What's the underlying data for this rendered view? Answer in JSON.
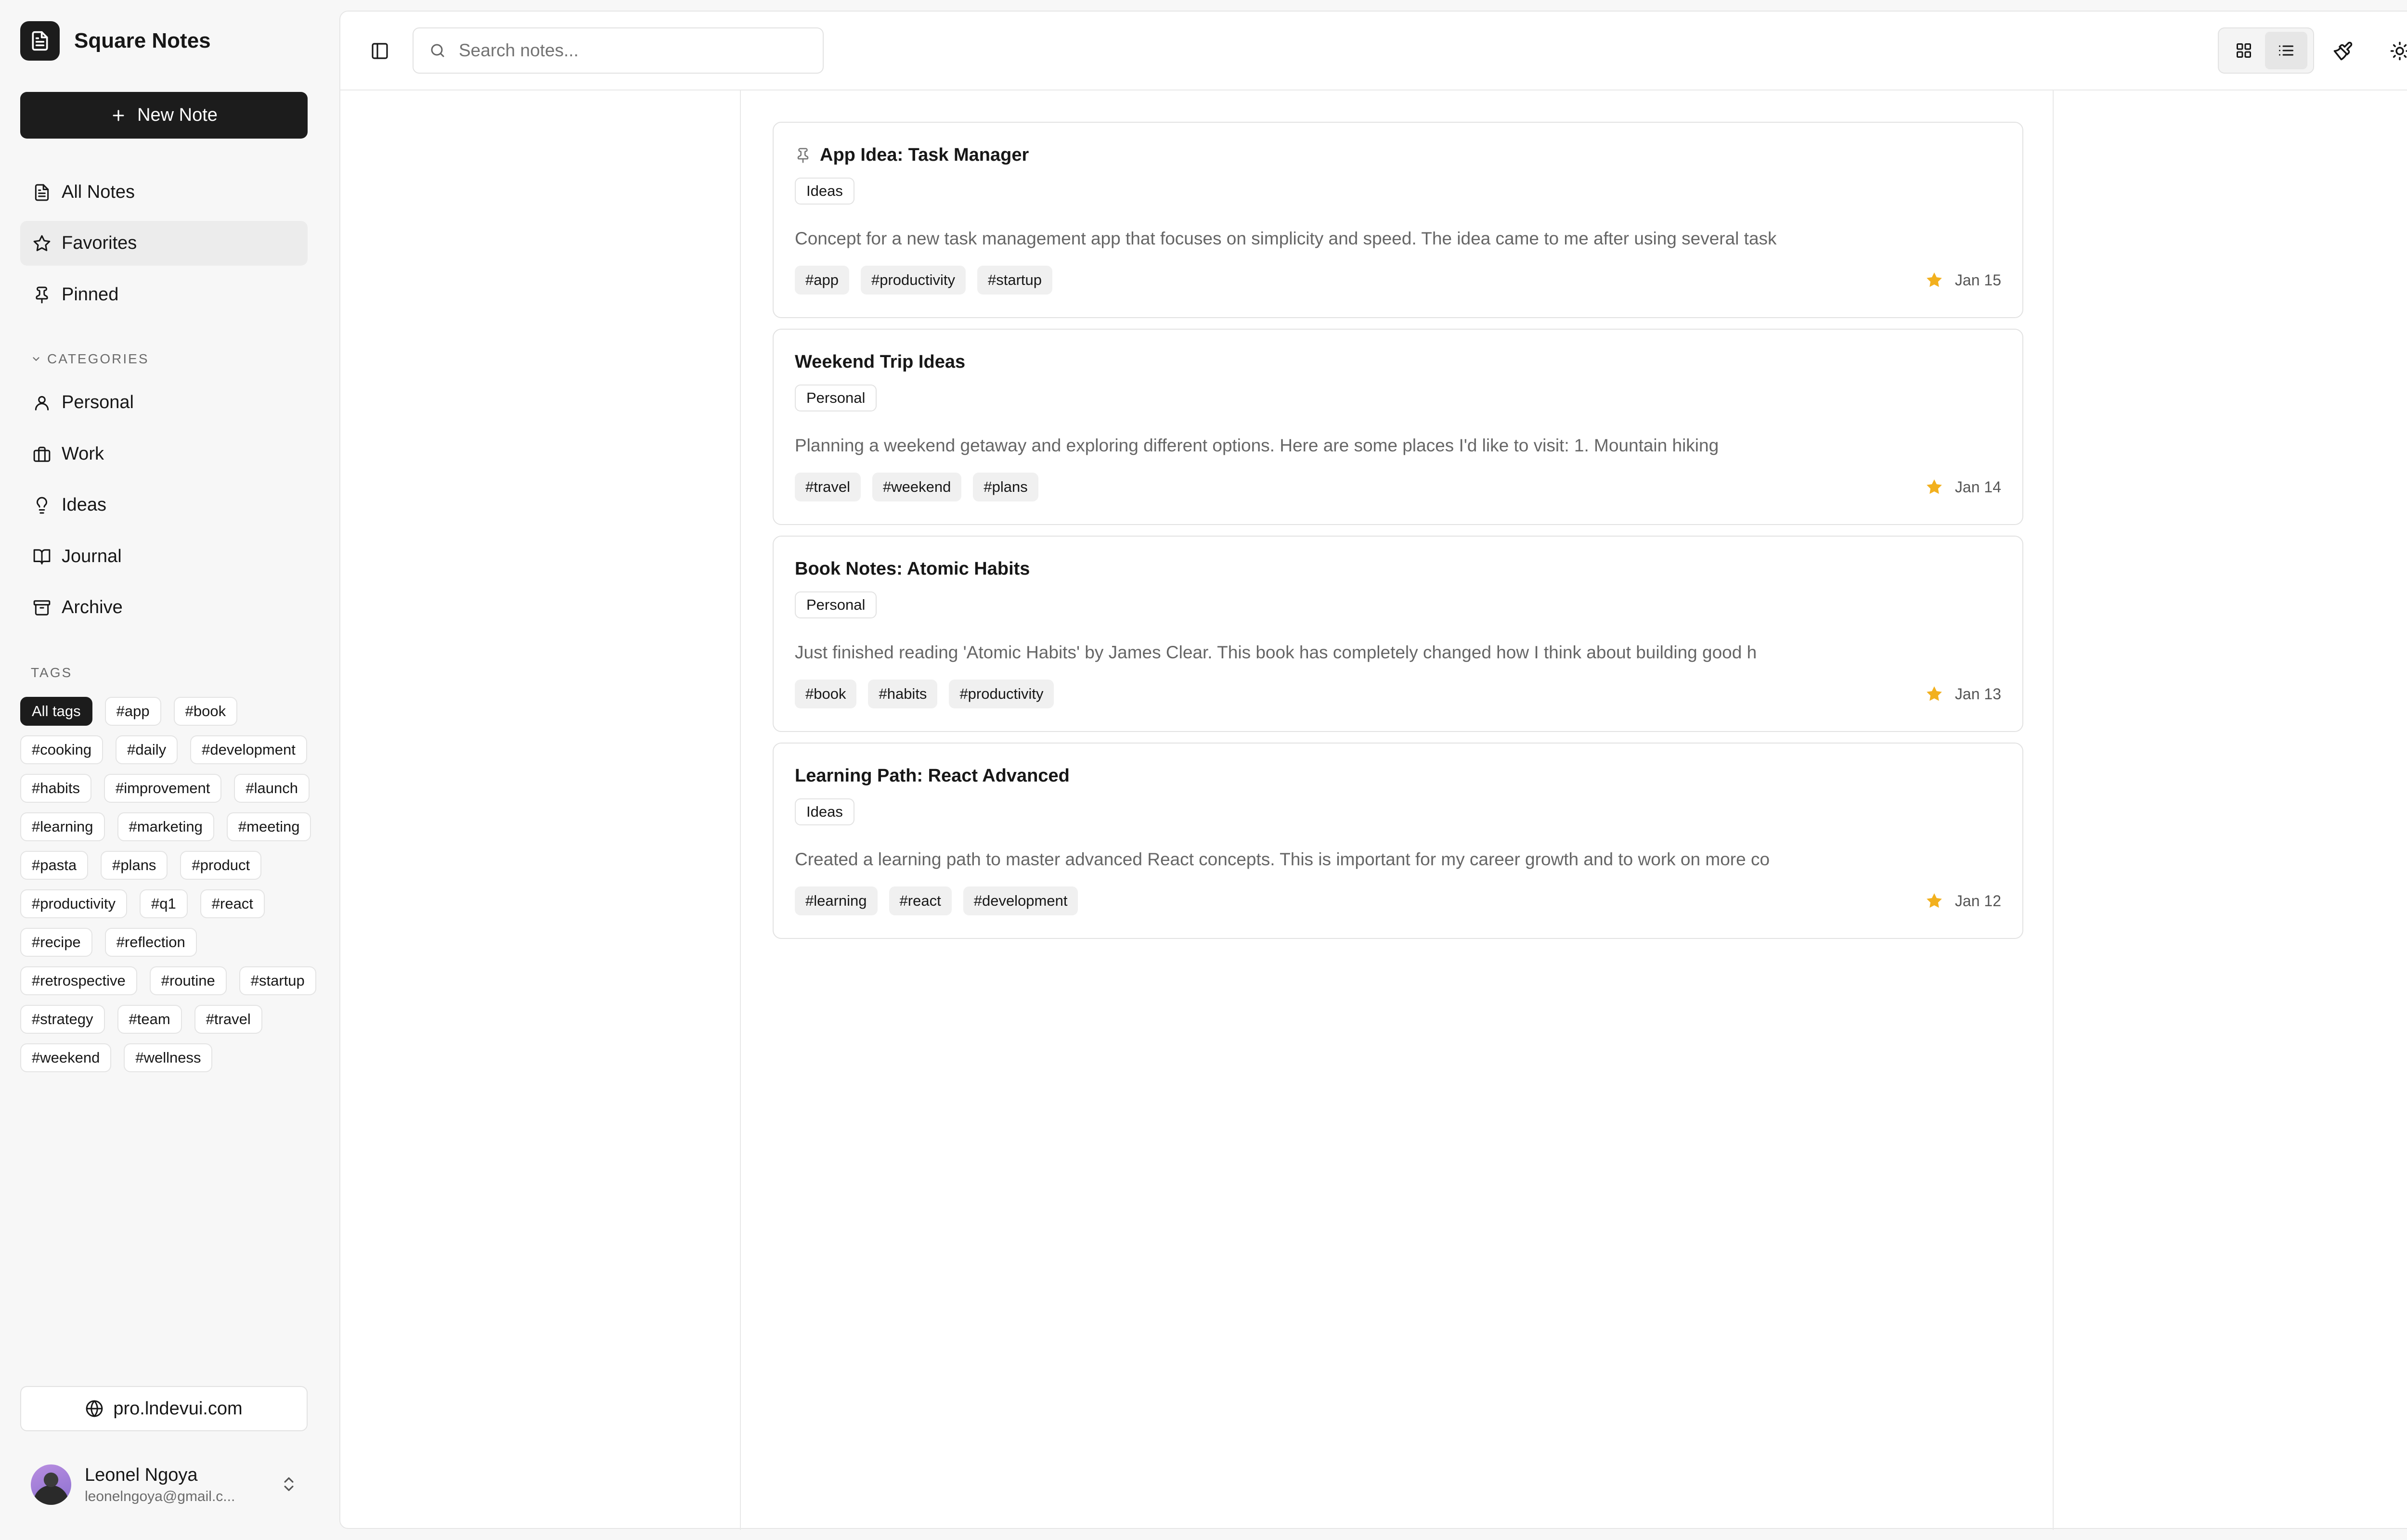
{
  "app": {
    "name": "Square Notes",
    "new_note_label": "New Note"
  },
  "nav": [
    {
      "label": "All Notes",
      "icon": "file-text-icon"
    },
    {
      "label": "Favorites",
      "icon": "star-icon",
      "active": true
    },
    {
      "label": "Pinned",
      "icon": "pin-icon"
    }
  ],
  "categories": {
    "heading": "CATEGORIES",
    "items": [
      {
        "label": "Personal",
        "icon": "user-icon"
      },
      {
        "label": "Work",
        "icon": "briefcase-icon"
      },
      {
        "label": "Ideas",
        "icon": "lightbulb-icon"
      },
      {
        "label": "Journal",
        "icon": "book-open-icon"
      },
      {
        "label": "Archive",
        "icon": "archive-icon"
      }
    ]
  },
  "tags": {
    "heading": "TAGS",
    "items": [
      "All tags",
      "#app",
      "#book",
      "#cooking",
      "#daily",
      "#development",
      "#habits",
      "#improvement",
      "#launch",
      "#learning",
      "#marketing",
      "#meeting",
      "#pasta",
      "#plans",
      "#product",
      "#productivity",
      "#q1",
      "#react",
      "#recipe",
      "#reflection",
      "#retrospective",
      "#routine",
      "#startup",
      "#strategy",
      "#team",
      "#travel",
      "#weekend",
      "#wellness"
    ],
    "active_index": 0
  },
  "footer": {
    "site_link": "pro.lndevui.com"
  },
  "user": {
    "name": "Leonel Ngoya",
    "email": "leonelngoya@gmail.c..."
  },
  "search": {
    "placeholder": "Search notes..."
  },
  "colors": {
    "accent_dark": "#1c1c1c",
    "star": "#f2b01e"
  },
  "notes": [
    {
      "title": "App Idea: Task Manager",
      "pinned": true,
      "category": "Ideas",
      "excerpt": "Concept for a new task management app that focuses on simplicity and speed. The idea came to me after using several task",
      "tags": [
        "#app",
        "#productivity",
        "#startup"
      ],
      "favorite": true,
      "date": "Jan 15"
    },
    {
      "title": "Weekend Trip Ideas",
      "pinned": false,
      "category": "Personal",
      "excerpt": "Planning a weekend getaway and exploring different options. Here are some places I'd like to visit: 1. Mountain hiking",
      "tags": [
        "#travel",
        "#weekend",
        "#plans"
      ],
      "favorite": true,
      "date": "Jan 14"
    },
    {
      "title": "Book Notes: Atomic Habits",
      "pinned": false,
      "category": "Personal",
      "excerpt": "Just finished reading 'Atomic Habits' by James Clear. This book has completely changed how I think about building good h",
      "tags": [
        "#book",
        "#habits",
        "#productivity"
      ],
      "favorite": true,
      "date": "Jan 13"
    },
    {
      "title": "Learning Path: React Advanced",
      "pinned": false,
      "category": "Ideas",
      "excerpt": "Created a learning path to master advanced React concepts. This is important for my career growth and to work on more co",
      "tags": [
        "#learning",
        "#react",
        "#development"
      ],
      "favorite": true,
      "date": "Jan 12"
    }
  ]
}
